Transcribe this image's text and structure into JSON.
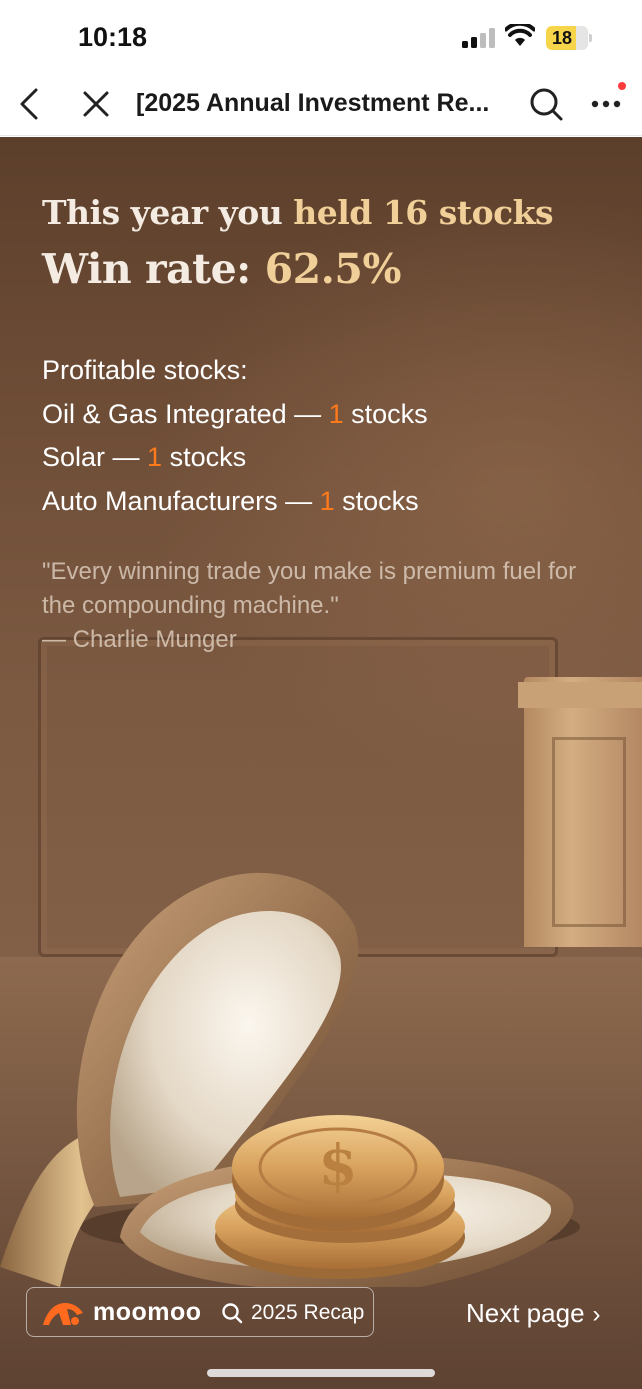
{
  "status_bar": {
    "time": "10:18",
    "battery": "18"
  },
  "nav": {
    "title": "[2025 Annual Investment Re..."
  },
  "card": {
    "headline_line1_prefix": "This year you ",
    "headline_line1_accent": "held 16 stocks",
    "headline_line2_prefix": "Win rate: ",
    "headline_line2_accent": "62.5%",
    "profitable_label": "Profitable stocks:",
    "profitable_items": [
      {
        "sector": "Oil & Gas Integrated — ",
        "count": "1",
        "unit": " stocks"
      },
      {
        "sector": "Solar — ",
        "count": "1",
        "unit": " stocks"
      },
      {
        "sector": "Auto Manufacturers — ",
        "count": "1",
        "unit": " stocks"
      }
    ],
    "quote_text": "\"Every winning trade you make is premium fuel for the compounding machine.\"",
    "quote_author": "— Charlie Munger"
  },
  "footer": {
    "brand": "moomoo",
    "recap_label": "2025 Recap",
    "next_label": "Next page",
    "next_chevron": "›"
  },
  "colors": {
    "accent_gold": "#f1cf98",
    "accent_orange": "#ff7a1a",
    "brand_orange": "#ff6a1f",
    "battery_yellow": "#f7d54a"
  },
  "icons": [
    "back-arrow-icon",
    "close-icon",
    "search-icon",
    "more-icon",
    "signal-icon",
    "wifi-icon",
    "battery-icon",
    "moomoo-logo-icon",
    "recap-search-icon",
    "chevron-right-icon"
  ]
}
